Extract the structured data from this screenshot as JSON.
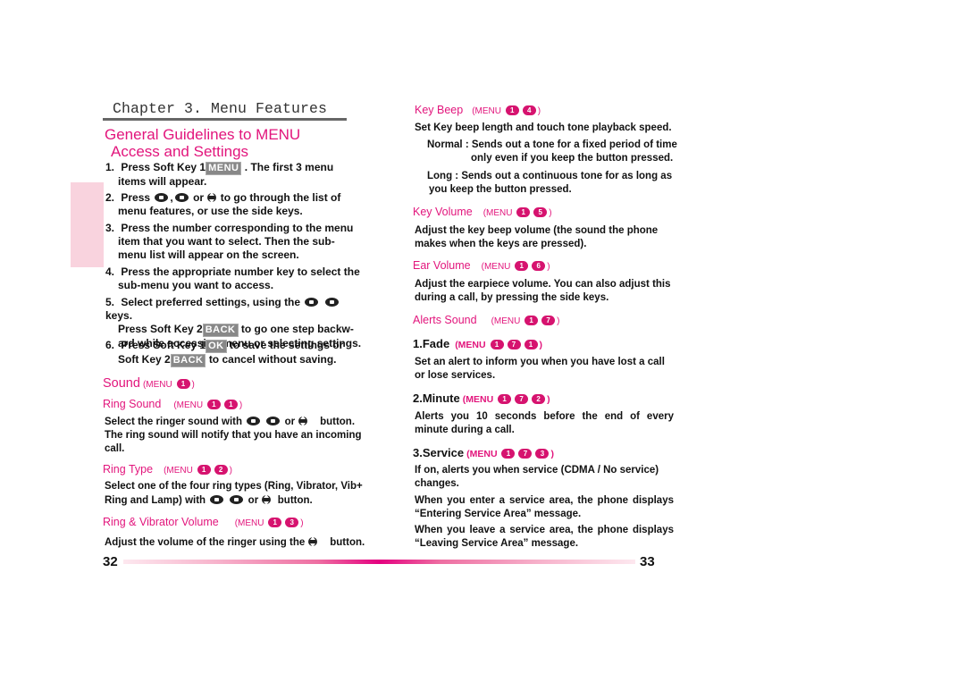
{
  "left_page": {
    "chapter_title": "Chapter 3. Menu Features",
    "guide_title_line1": "General Guidelines to MENU",
    "guide_title_line2": "Access and Settings",
    "steps": [
      {
        "num": "1.",
        "pre": "Press Soft Key 1",
        "badge": "MENU",
        "post": ". The first 3 menu",
        "cont": "items will appear."
      },
      {
        "num": "2.",
        "pre": "Press",
        "post": "to go through the list of",
        "cont": "menu features, or use the side keys."
      },
      {
        "num": "3.",
        "text": "Press the number corresponding to the menu",
        "cont1": "item that you want to select. Then the sub-",
        "cont2": "menu list will appear on the screen."
      },
      {
        "num": "4.",
        "text": "Press the appropriate number key to select the",
        "cont": "sub-menu you want to access."
      },
      {
        "num": "5.",
        "pre": "Select preferred settings, using the",
        "post": "keys.",
        "line2_pre": "Press Soft Key 2",
        "badge": "BACK",
        "line2_post": "to go one step backw-",
        "cont": "ard while accessing menu or selecting settings."
      },
      {
        "num": "6.",
        "pre": "Press Soft Key 1",
        "badge": "OK",
        "post": "to save the settings or",
        "line2_pre": "Soft Key 2",
        "badge2": "BACK",
        "line2_post": "to cancel without saving."
      }
    ],
    "sound": {
      "title": "Sound",
      "menu": "(MENU",
      "keys": [
        "1"
      ],
      "close": ")"
    },
    "ring_sound": {
      "title": "Ring Sound",
      "menu": "(MENU",
      "keys": [
        "1",
        "1"
      ],
      "close": ")",
      "line1_pre": "Select the ringer sound with",
      "line1_post": "button.",
      "line2": "The ring sound will notify that you have an incoming",
      "line3": "call."
    },
    "ring_type": {
      "title": "Ring Type",
      "menu": "(MENU",
      "keys": [
        "1",
        "2"
      ],
      "close": ")",
      "line1": "Select one of the four ring types (Ring, Vibrator, Vib+",
      "line2_pre": "Ring and Lamp) with",
      "line2_post": "button."
    },
    "ring_vibrator_volume": {
      "title": "Ring & Vibrator Volume",
      "menu": "(MENU",
      "keys": [
        "1",
        "3"
      ],
      "close": ")",
      "line_pre": "Adjust the volume of the ringer using the",
      "line_post": "button."
    },
    "page_number": "32"
  },
  "right_page": {
    "key_beep": {
      "title": "Key Beep",
      "menu": "(MENU",
      "keys": [
        "1",
        "4"
      ],
      "close": ")",
      "line": "Set Key beep length and touch tone playback speed.",
      "normal1": "Normal : Sends out a tone for a fixed period of time",
      "normal2": "only even if you keep the button pressed.",
      "long1": "Long : Sends out a continuous tone for as long as",
      "long2": "you keep the button pressed."
    },
    "key_volume": {
      "title": "Key Volume",
      "menu": "(MENU",
      "keys": [
        "1",
        "5"
      ],
      "close": ")",
      "line1": "Adjust the key beep volume (the sound the phone",
      "line2": "makes when the keys are pressed)."
    },
    "ear_volume": {
      "title": "Ear Volume",
      "menu": "(MENU",
      "keys": [
        "1",
        "6"
      ],
      "close": ")",
      "line1": "Adjust the earpiece volume. You can also adjust this",
      "line2": "during a call, by pressing the side keys."
    },
    "alerts_sound": {
      "title": "Alerts Sound",
      "menu": "(MENU",
      "keys": [
        "1",
        "7"
      ],
      "close": ")"
    },
    "fade": {
      "title": "1.Fade",
      "menu": "(MENU",
      "keys": [
        "1",
        "7",
        "1"
      ],
      "close": ")",
      "line1": "Set an alert to inform you when you have lost a call",
      "line2": "or lose services."
    },
    "minute": {
      "title": "2.Minute",
      "menu": "(MENU",
      "keys": [
        "1",
        "7",
        "2"
      ],
      "close": ")",
      "line1": "Alerts you 10 seconds before the end of every",
      "line2": "minute during a call."
    },
    "service": {
      "title": "3.Service",
      "menu": "(MENU",
      "keys": [
        "1",
        "7",
        "3"
      ],
      "close": ")",
      "line1": "If on, alerts you when service (CDMA / No service)",
      "line2": "changes.",
      "enter1": "When you enter a service area, the phone displays",
      "enter2": "“Entering Service Area” message.",
      "leave1": "When you leave a service area, the phone displays",
      "leave2": "“Leaving Service Area” message."
    },
    "page_number": "33"
  },
  "colors": {
    "accent_pink": "#e2157c",
    "menu_dot": "#d6136f",
    "side_tab": "#f9d3de",
    "badge_gray": "#888888"
  }
}
